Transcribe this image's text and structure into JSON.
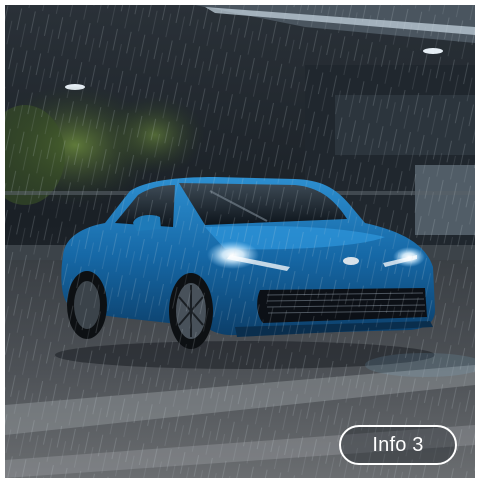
{
  "image": {
    "subject": "car-photo",
    "accent_color": "#1f7fc4"
  },
  "info_button": {
    "label": "Info 3",
    "border_color": "#ffffff",
    "text_color": "#ffffff"
  }
}
